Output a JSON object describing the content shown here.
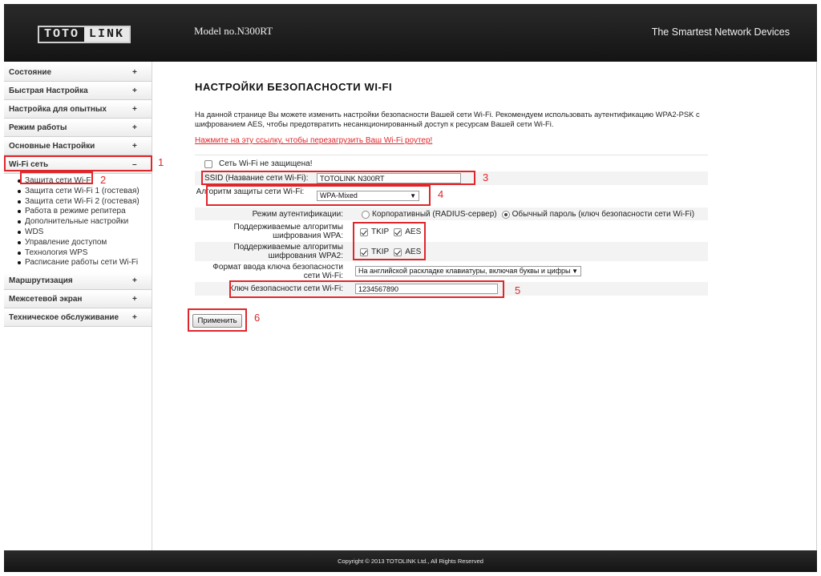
{
  "header": {
    "logo_left": "TOTO",
    "logo_right": "LINK",
    "model": "Model no.N300RT",
    "slogan": "The Smartest Network Devices"
  },
  "sidebar": {
    "items": [
      {
        "label": "Состояние",
        "sign": "+"
      },
      {
        "label": "Быстрая Настройка",
        "sign": "+"
      },
      {
        "label": "Настройка для опытных",
        "sign": "+"
      },
      {
        "label": "Режим работы",
        "sign": "+"
      },
      {
        "label": "Основные Настройки",
        "sign": "+"
      },
      {
        "label": "Wi-Fi сеть",
        "sign": "–"
      },
      {
        "label": "Маршрутизация",
        "sign": "+"
      },
      {
        "label": "Межсетевой экран",
        "sign": "+"
      },
      {
        "label": "Техническое обслуживание",
        "sign": "+"
      }
    ],
    "wifi_submenu": [
      "Защита сети Wi-Fi",
      "Защита сети Wi-Fi 1 (гостевая)",
      "Защита сети Wi-Fi 2 (гостевая)",
      "Работа в режиме репитера",
      "Дополнительные настройки",
      "WDS",
      "Управление доступом",
      "Технология WPS",
      "Расписание работы сети Wi-Fi"
    ]
  },
  "main": {
    "title": "НАСТРОЙКИ БЕЗОПАСНОСТИ WI-FI",
    "description": "На данной странице Вы можете изменить настройки безопасности Вашей сети Wi-Fi. Рекомендуем использовать аутентификацию WPA2-PSK с шифрованием AES, чтобы предотвратить несанкционированный доступ к ресурсам Вашей сети Wi-Fi.",
    "reload_link": "Нажмите на эту ссылку, чтобы перезагрузить Ваш Wi-Fi роутер!",
    "unprotected_label": "Сеть Wi-Fi не защищена!",
    "ssid_label": "SSID (Название сети Wi-Fi):",
    "ssid_value": "TOTOLINK N300RT",
    "algo_label": "Алгоритм защиты сети Wi-Fi:",
    "algo_value": "WPA-Mixed",
    "auth_label": "Режим аутентификации:",
    "auth_option1": "Корпоративный (RADIUS-сервер)",
    "auth_option2": "Обычный пароль (ключ безопасности сети Wi-Fi)",
    "wpa_label": "Поддерживаемые алгоритмы шифрования WPA:",
    "wpa2_label": "Поддерживаемые алгоритмы шифрования WPA2:",
    "tkip": "TKIP",
    "aes": "AES",
    "keyformat_label": "Формат ввода ключа безопасности сети Wi-Fi:",
    "keyformat_value": "На английской раскладке клавиатуры, включая буквы и цифры",
    "key_label": "Ключ безопасности сети Wi-Fi:",
    "key_value": "1234567890",
    "apply": "Применить"
  },
  "annotations": [
    "1",
    "2",
    "3",
    "4",
    "5",
    "6"
  ],
  "footer": {
    "copyright": "Copyright © 2013 TOTOLINK Ltd.,   All Rights Reserved"
  },
  "colors": {
    "header_bg": "#1c1c1c",
    "annotation_red": "#e0262b",
    "link_red": "#e0262b"
  }
}
